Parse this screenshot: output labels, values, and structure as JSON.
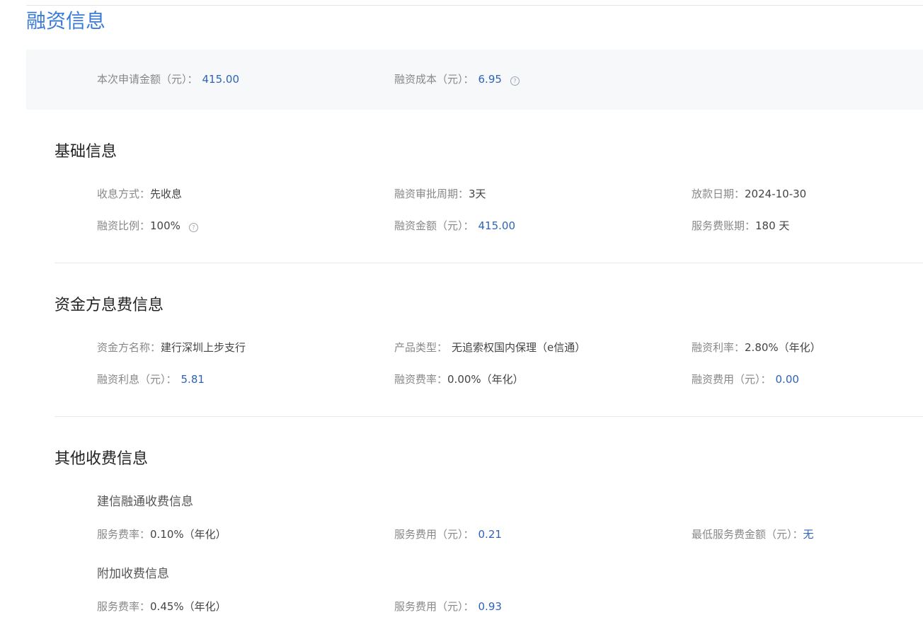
{
  "title": "融资信息",
  "summary": {
    "apply_amount": {
      "label": "本次申请金额（元）：",
      "value": "415.00"
    },
    "financing_cost": {
      "label": "融资成本（元）：",
      "value": "6.95"
    },
    "help_glyph": "?"
  },
  "basic": {
    "title": "基础信息",
    "interest_method": {
      "label": "收息方式：",
      "value": "先收息"
    },
    "approval_period": {
      "label": "融资审批周期：",
      "value": "3天"
    },
    "loan_date": {
      "label": "放款日期：",
      "value": "2024-10-30"
    },
    "financing_ratio": {
      "label": "融资比例：",
      "value": "100%"
    },
    "financing_amount": {
      "label": "融资金额（元）：",
      "value": "415.00"
    },
    "service_fee_period": {
      "label": "服务费账期：",
      "value": "180 天"
    }
  },
  "funder": {
    "title": "资金方息费信息",
    "funder_name": {
      "label": "资金方名称：",
      "value": "建行深圳上步支行"
    },
    "product_type": {
      "label": "产品类型：",
      "value": "无追索权国内保理（e信通）"
    },
    "financing_rate": {
      "label": "融资利率：",
      "value": "2.80%（年化）"
    },
    "financing_interest": {
      "label": "融资利息（元）：",
      "value": "5.81"
    },
    "financing_fee_rate": {
      "label": "融资费率：",
      "value": "0.00%（年化）"
    },
    "financing_fee": {
      "label": "融资费用（元）：",
      "value": "0.00"
    }
  },
  "other": {
    "title": "其他收费信息",
    "jianxin": {
      "subtitle": "建信融通收费信息",
      "service_rate": {
        "label": "服务费率：",
        "value": "0.10%（年化）"
      },
      "service_fee": {
        "label": "服务费用（元）：",
        "value": "0.21"
      },
      "min_service_fee": {
        "label": "最低服务费金额（元）：",
        "value": "无"
      }
    },
    "extra": {
      "subtitle": "附加收费信息",
      "service_rate": {
        "label": "服务费率：",
        "value": "0.45%（年化）"
      },
      "service_fee": {
        "label": "服务费用（元）：",
        "value": "0.93"
      }
    }
  }
}
